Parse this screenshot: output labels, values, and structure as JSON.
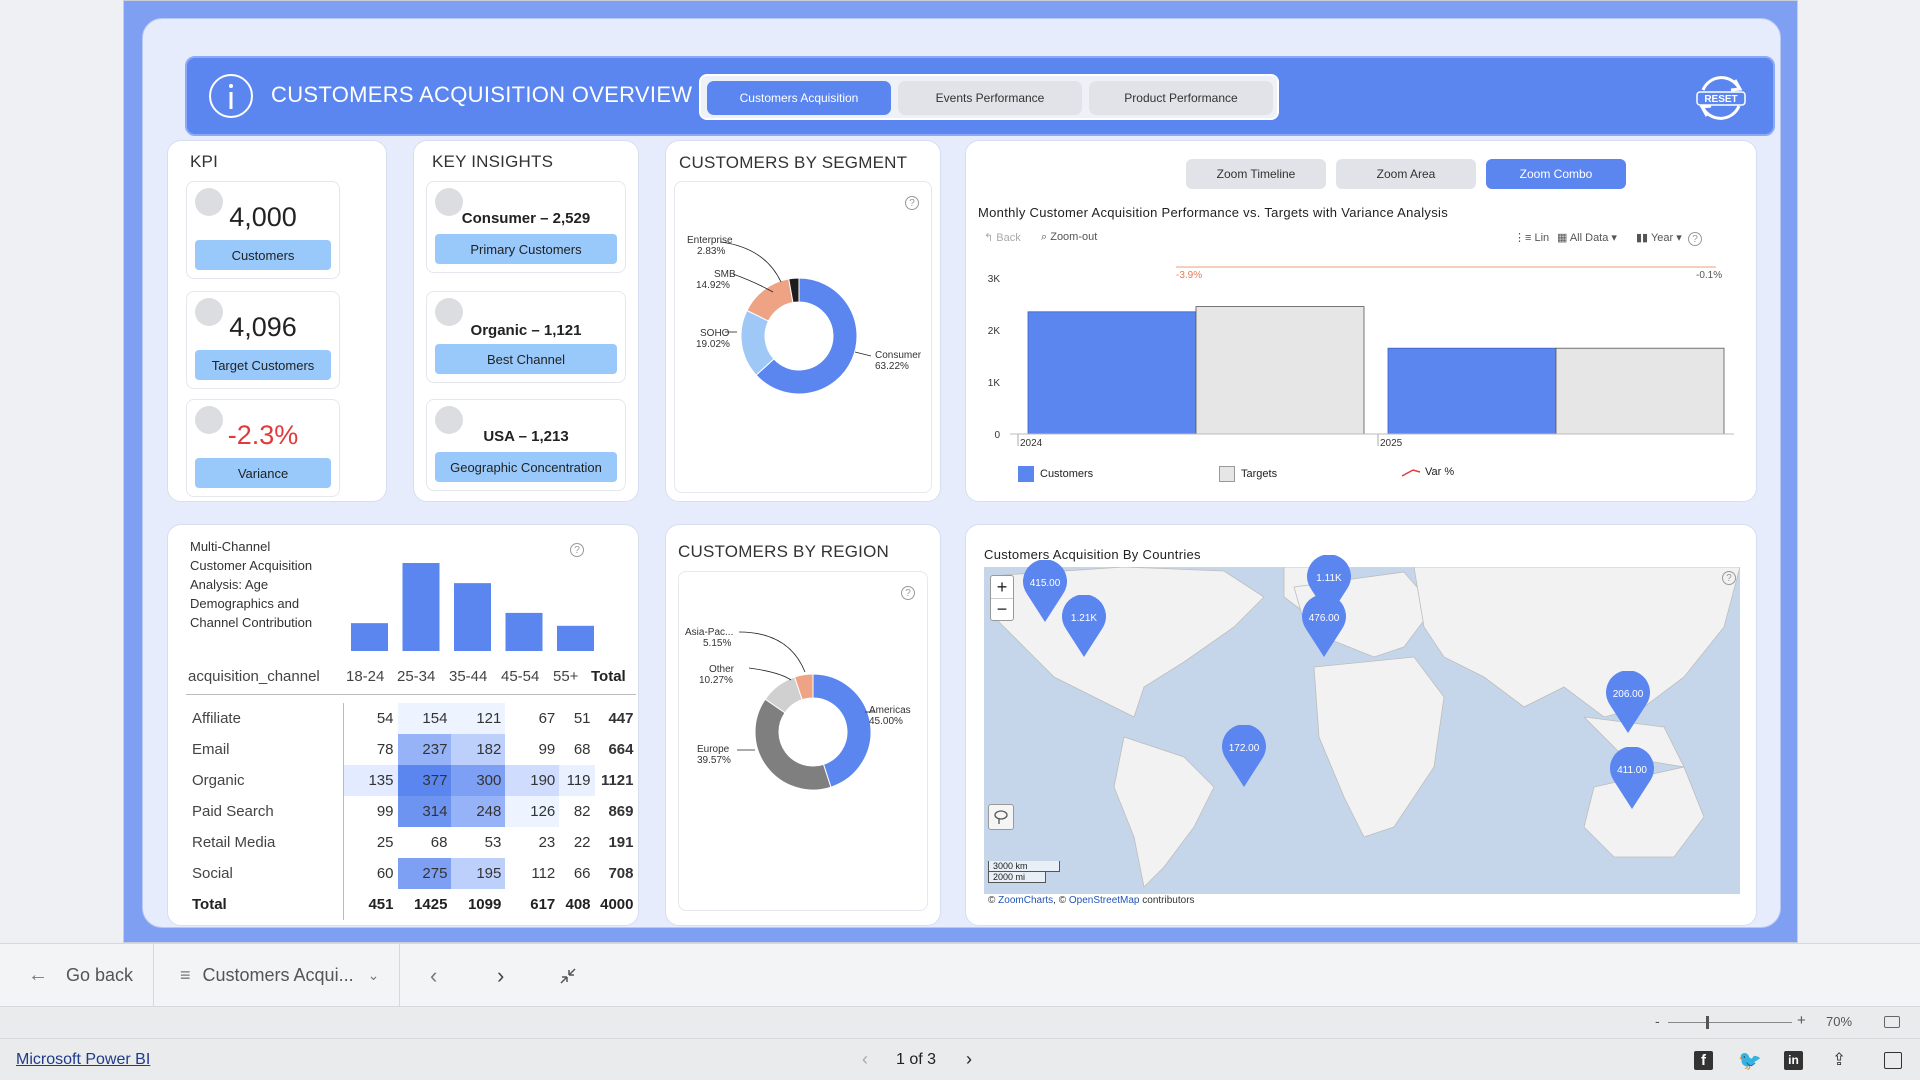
{
  "header": {
    "title": "CUSTOMERS ACQUISITION OVERVIEW",
    "tabs": [
      "Customers Acquisition",
      "Events Performance",
      "Product Performance"
    ],
    "active_tab": "Customers Acquisition",
    "reset_label": "RESET"
  },
  "kpi": {
    "title": "KPI",
    "tiles": [
      {
        "value": "4,000",
        "label": "Customers"
      },
      {
        "value": "4,096",
        "label": "Target Customers"
      },
      {
        "value": "-2.3%",
        "label": "Variance"
      }
    ]
  },
  "insights": {
    "title": "KEY INSIGHTS",
    "tiles": [
      {
        "value": "Consumer – 2,529",
        "label": "Primary Customers"
      },
      {
        "value": "Organic – 1,121",
        "label": "Best Channel"
      },
      {
        "value": "USA – 1,213",
        "label": "Geographic Concentration"
      }
    ]
  },
  "segment": {
    "title": "CUSTOMERS BY SEGMENT",
    "labels": [
      {
        "name": "Enterprise",
        "pct": "2.83%"
      },
      {
        "name": "SMB",
        "pct": "14.92%"
      },
      {
        "name": "SOHO",
        "pct": "19.02%"
      },
      {
        "name": "Consumer",
        "pct": "63.22%"
      }
    ]
  },
  "region": {
    "title": "CUSTOMERS BY REGION",
    "labels": [
      {
        "name": "Asia-Pac...",
        "pct": "5.15%"
      },
      {
        "name": "Other",
        "pct": "10.27%"
      },
      {
        "name": "Europe",
        "pct": "39.57%"
      },
      {
        "name": "Americas",
        "pct": "45.00%"
      }
    ]
  },
  "combo": {
    "zoom_buttons": [
      "Zoom Timeline",
      "Zoom Area",
      "Zoom Combo"
    ],
    "active_zoom": "Zoom Combo",
    "title": "Monthly Customer Acquisition Performance vs. Targets with Variance Analysis",
    "toolbar": {
      "back": "Back",
      "zoom_out": "Zoom-out",
      "lin": "Lin",
      "all_data": "All Data",
      "year": "Year"
    },
    "y_ticks": [
      "3K",
      "2K",
      "1K",
      "0"
    ],
    "legend": [
      "Customers",
      "Targets",
      "Var %"
    ]
  },
  "map": {
    "title": "Customers Acquisition By Countries",
    "markers": [
      "415.00",
      "1.21K",
      "1.11K",
      "476.00",
      "206.00",
      "172.00",
      "411.00"
    ],
    "scale_km": "3000 km",
    "scale_mi": "2000 mi",
    "attribution_prefix": "©",
    "attribution_zc": "ZoomCharts",
    "attribution_mid": ", ©",
    "attribution_osm": "OpenStreetMap",
    "attribution_suffix": "contributors",
    "zoom_in": "+",
    "zoom_out": "−"
  },
  "matrix": {
    "title_lines": [
      "Multi-Channel",
      "Customer Acquisition",
      "Analysis: Age",
      "Demographics and",
      "Channel Contribution"
    ],
    "row_header": "acquisition_channel",
    "columns": [
      "18-24",
      "25-34",
      "35-44",
      "45-54",
      "55+",
      "Total"
    ],
    "rows": [
      {
        "label": "Affiliate",
        "values": [
          "54",
          "154",
          "121",
          "67",
          "51",
          "447"
        ]
      },
      {
        "label": "Email",
        "values": [
          "78",
          "237",
          "182",
          "99",
          "68",
          "664"
        ]
      },
      {
        "label": "Organic",
        "values": [
          "135",
          "377",
          "300",
          "190",
          "119",
          "1121"
        ]
      },
      {
        "label": "Paid Search",
        "values": [
          "99",
          "314",
          "248",
          "126",
          "82",
          "869"
        ]
      },
      {
        "label": "Retail Media",
        "values": [
          "25",
          "68",
          "53",
          "23",
          "22",
          "191"
        ]
      },
      {
        "label": "Social",
        "values": [
          "60",
          "275",
          "195",
          "112",
          "66",
          "708"
        ]
      }
    ],
    "total": {
      "label": "Total",
      "values": [
        "451",
        "1425",
        "1099",
        "617",
        "408",
        "4000"
      ]
    }
  },
  "chart_data": [
    {
      "type": "pie",
      "title": "CUSTOMERS BY SEGMENT",
      "categories": [
        "Consumer",
        "SOHO",
        "SMB",
        "Enterprise"
      ],
      "values": [
        63.22,
        19.02,
        14.92,
        2.83
      ],
      "colors": [
        "#5b86f0",
        "#9fc8f7",
        "#eea384",
        "#1d1d1d"
      ]
    },
    {
      "type": "pie",
      "title": "CUSTOMERS BY REGION",
      "categories": [
        "Americas",
        "Europe",
        "Other",
        "Asia-Pac..."
      ],
      "values": [
        45.0,
        39.57,
        10.27,
        5.15
      ],
      "colors": [
        "#5b86f0",
        "#7f7f7f",
        "#d0d0d0",
        "#eea384"
      ]
    },
    {
      "type": "bar",
      "title": "Monthly Customer Acquisition Performance vs. Targets with Variance Analysis",
      "categories": [
        "2024",
        "2025"
      ],
      "series": [
        {
          "name": "Customers",
          "values": [
            2350,
            1650
          ]
        },
        {
          "name": "Targets",
          "values": [
            2450,
            1650
          ]
        },
        {
          "name": "Var %",
          "values": [
            -3.9,
            -0.1
          ]
        }
      ],
      "variance_labels": [
        "-3.9%",
        "-0.1%"
      ],
      "ylim": [
        0,
        3000
      ]
    },
    {
      "type": "bar",
      "title": "",
      "categories": [
        "18-24",
        "25-34",
        "35-44",
        "45-54",
        "55+"
      ],
      "values": [
        451,
        1425,
        1099,
        617,
        408
      ]
    }
  ],
  "bottom_nav": {
    "go_back": "Go back",
    "page_selector": "Customers Acqui...",
    "page_indicator": "1 of 3",
    "zoom_level": "70%",
    "product": "Microsoft Power BI"
  },
  "colors": {
    "accent": "#5b86f0",
    "header_bg": "#5b86f0",
    "pill": "#99c8fb",
    "negative": "#e23a3a"
  }
}
